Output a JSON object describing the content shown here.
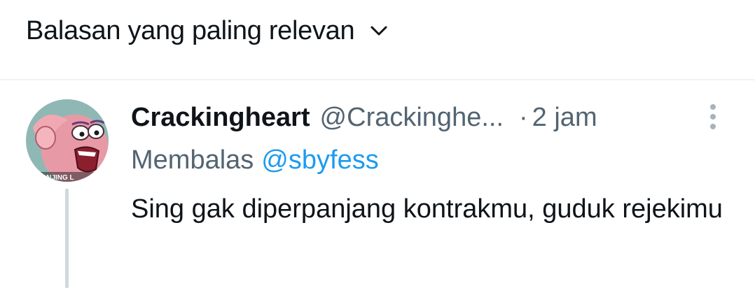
{
  "sort": {
    "label": "Balasan yang paling relevan",
    "icon": "chevron-down-icon"
  },
  "tweet": {
    "display_name": "Crackingheart",
    "handle": "@Crackinghe...",
    "separator": "·",
    "time": "2 jam",
    "more_icon": "more-vertical-icon",
    "reply_prefix": "Membalas",
    "reply_to": "@sbyfess",
    "text": "Sing gak diperpanjang kontrakmu, guduk rejekimu",
    "avatar_caption": "ANJING L"
  },
  "colors": {
    "text_primary": "#0f1419",
    "text_secondary": "#536471",
    "accent": "#1d9bf0",
    "divider": "#eff3f4",
    "thread_line": "#cfd9de"
  }
}
